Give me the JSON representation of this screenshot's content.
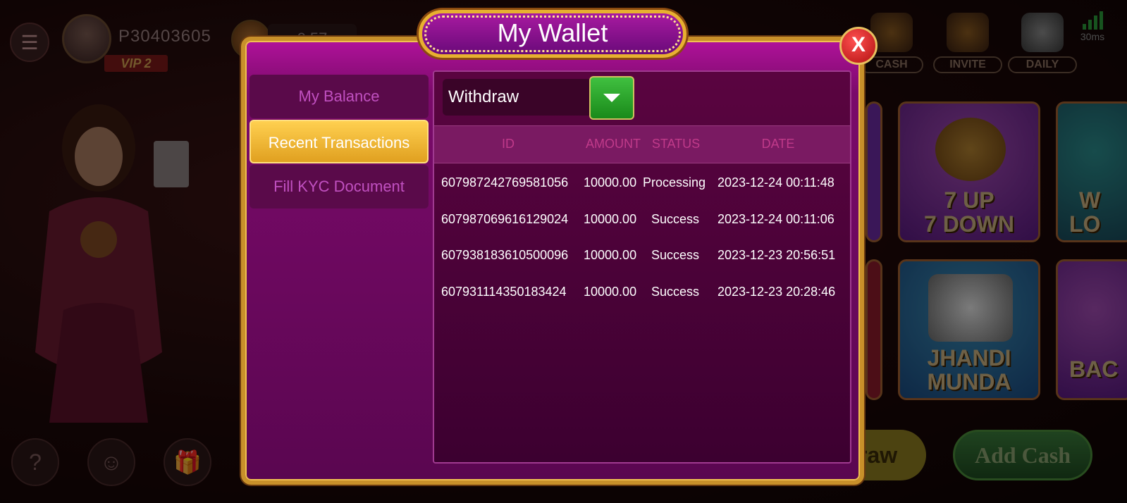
{
  "topbar": {
    "player_id": "P30403605",
    "vip_label": "VIP 2",
    "balance_partial": "0.57",
    "buttons": [
      {
        "label": "CASH",
        "icon": "cash-icon"
      },
      {
        "label": "INVITE",
        "icon": "megaphone-icon"
      },
      {
        "label": "DAILY",
        "icon": "calendar-icon"
      }
    ],
    "ping": "30ms"
  },
  "games": {
    "tile1": [
      "7 UP",
      "7 DOWN"
    ],
    "tile2": [
      "JHANDI",
      "MUNDA"
    ],
    "tile3_partial": [
      "W",
      "LO"
    ],
    "tile4_partial": "BAC"
  },
  "bottom": {
    "withdraw_partial": "raw",
    "add_cash": "Add Cash"
  },
  "wallet": {
    "title": "My Wallet",
    "close": "X",
    "sidebar": [
      {
        "label": "My Balance",
        "active": false
      },
      {
        "label": "Recent Transactions",
        "active": true
      },
      {
        "label": "Fill KYC Document",
        "active": false
      }
    ],
    "filter_value": "Withdraw",
    "columns": [
      "ID",
      "AMOUNT",
      "STATUS",
      "DATE"
    ],
    "transactions": [
      {
        "id": "607987242769581056",
        "amount": "10000.00",
        "status": "Processing",
        "date": "2023-12-24 00:11:48"
      },
      {
        "id": "607987069616129024",
        "amount": "10000.00",
        "status": "Success",
        "date": "2023-12-24 00:11:06"
      },
      {
        "id": "607938183610500096",
        "amount": "10000.00",
        "status": "Success",
        "date": "2023-12-23 20:56:51"
      },
      {
        "id": "607931114350183424",
        "amount": "10000.00",
        "status": "Success",
        "date": "2023-12-23 20:28:46"
      }
    ]
  },
  "colors": {
    "modal_bg": "#7a0a6a",
    "gold_border": "#c8902a",
    "active_tab": "#ffd050",
    "header_text": "#c03a8a"
  }
}
